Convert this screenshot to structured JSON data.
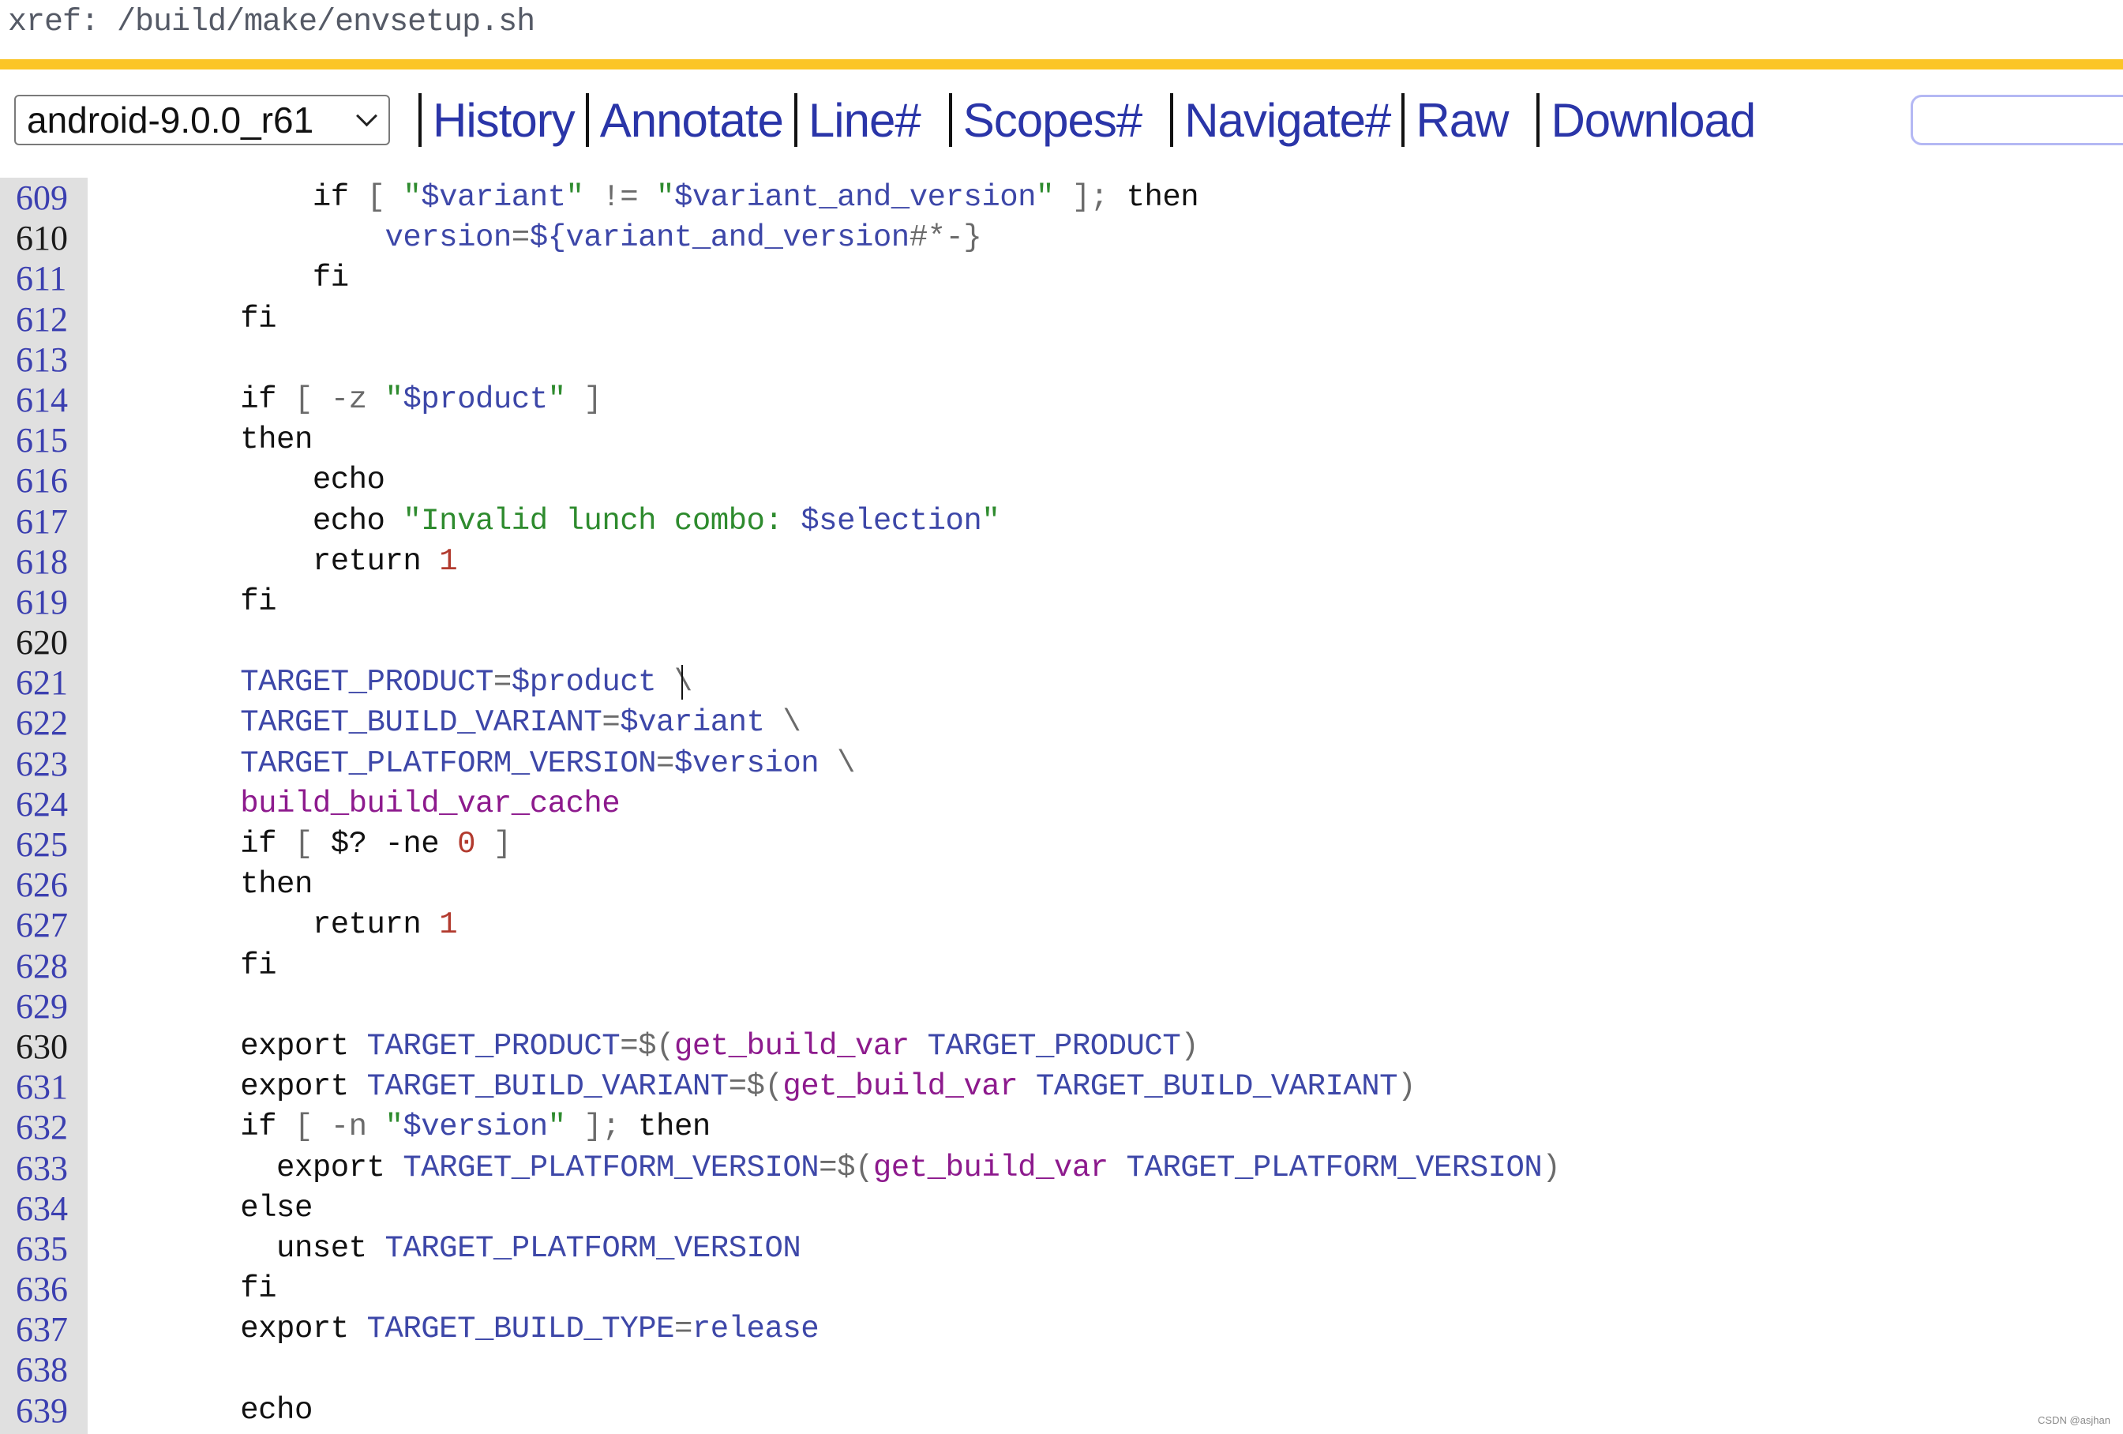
{
  "header": {
    "title": "xref: /build/make/envsetup.sh"
  },
  "toolbar": {
    "branch_select": {
      "value": "android-9.0.0_r61",
      "icon": "chevron-down-icon"
    },
    "links": [
      "History",
      "Annotate",
      "Line#",
      "Scopes#",
      "Navigate#",
      "Raw",
      "Download"
    ],
    "search": {
      "value": "",
      "placeholder": ""
    }
  },
  "colors": {
    "accent_bar": "#fbc527",
    "link": "#2a35a8",
    "line_number": "#3b3fb0",
    "gutter": "#e0e0e0",
    "string": "#2e8b2e",
    "variable": "#3d47a8",
    "number": "#b23a2e",
    "function": "#8d1a8d"
  },
  "code": {
    "lines": [
      {
        "n": "609",
        "tokens": [
          [
            "k",
            "            if "
          ],
          [
            "p",
            "[ "
          ],
          [
            "s",
            "\""
          ],
          [
            "v",
            "$variant"
          ],
          [
            "s",
            "\""
          ],
          [
            "p",
            " != "
          ],
          [
            "s",
            "\""
          ],
          [
            "v",
            "$variant_and_version"
          ],
          [
            "s",
            "\""
          ],
          [
            "p",
            " ]; "
          ],
          [
            "k",
            "then"
          ]
        ]
      },
      {
        "n": "610",
        "tokens": [
          [
            "v",
            "                version"
          ],
          [
            "p",
            "="
          ],
          [
            "v",
            "${variant_and_version"
          ],
          [
            "p",
            "#*-}"
          ]
        ]
      },
      {
        "n": "611",
        "tokens": [
          [
            "k",
            "            fi"
          ]
        ]
      },
      {
        "n": "612",
        "tokens": [
          [
            "k",
            "        fi"
          ]
        ]
      },
      {
        "n": "613",
        "tokens": []
      },
      {
        "n": "614",
        "tokens": [
          [
            "k",
            "        if "
          ],
          [
            "p",
            "[ -z "
          ],
          [
            "s",
            "\""
          ],
          [
            "v",
            "$product"
          ],
          [
            "s",
            "\""
          ],
          [
            "p",
            " ]"
          ]
        ]
      },
      {
        "n": "615",
        "tokens": [
          [
            "k",
            "        then"
          ]
        ]
      },
      {
        "n": "616",
        "tokens": [
          [
            "k",
            "            echo"
          ]
        ]
      },
      {
        "n": "617",
        "tokens": [
          [
            "k",
            "            echo "
          ],
          [
            "s",
            "\"Invalid lunch combo: "
          ],
          [
            "v",
            "$selection"
          ],
          [
            "s",
            "\""
          ]
        ]
      },
      {
        "n": "618",
        "tokens": [
          [
            "k",
            "            return "
          ],
          [
            "n",
            "1"
          ]
        ]
      },
      {
        "n": "619",
        "tokens": [
          [
            "k",
            "        fi"
          ]
        ]
      },
      {
        "n": "620",
        "tokens": []
      },
      {
        "n": "621",
        "tokens": [
          [
            "v",
            "        TARGET_PRODUCT"
          ],
          [
            "p",
            "="
          ],
          [
            "v",
            "$product"
          ],
          [
            "p",
            " \\"
          ]
        ],
        "cursor": true
      },
      {
        "n": "622",
        "tokens": [
          [
            "v",
            "        TARGET_BUILD_VARIANT"
          ],
          [
            "p",
            "="
          ],
          [
            "v",
            "$variant"
          ],
          [
            "p",
            " \\"
          ]
        ]
      },
      {
        "n": "623",
        "tokens": [
          [
            "v",
            "        TARGET_PLATFORM_VERSION"
          ],
          [
            "p",
            "="
          ],
          [
            "v",
            "$version"
          ],
          [
            "p",
            " \\"
          ]
        ]
      },
      {
        "n": "624",
        "tokens": [
          [
            "f",
            "        build_build_var_cache"
          ]
        ]
      },
      {
        "n": "625",
        "tokens": [
          [
            "k",
            "        if "
          ],
          [
            "p",
            "[ "
          ],
          [
            "k",
            "$? -ne "
          ],
          [
            "n",
            "0"
          ],
          [
            "p",
            " ]"
          ]
        ]
      },
      {
        "n": "626",
        "tokens": [
          [
            "k",
            "        then"
          ]
        ]
      },
      {
        "n": "627",
        "tokens": [
          [
            "k",
            "            return "
          ],
          [
            "n",
            "1"
          ]
        ]
      },
      {
        "n": "628",
        "tokens": [
          [
            "k",
            "        fi"
          ]
        ]
      },
      {
        "n": "629",
        "tokens": []
      },
      {
        "n": "630",
        "tokens": [
          [
            "k",
            "        export "
          ],
          [
            "v",
            "TARGET_PRODUCT"
          ],
          [
            "p",
            "=$("
          ],
          [
            "f",
            "get_build_var"
          ],
          [
            "v",
            " TARGET_PRODUCT"
          ],
          [
            "p",
            ")"
          ]
        ]
      },
      {
        "n": "631",
        "tokens": [
          [
            "k",
            "        export "
          ],
          [
            "v",
            "TARGET_BUILD_VARIANT"
          ],
          [
            "p",
            "=$("
          ],
          [
            "f",
            "get_build_var"
          ],
          [
            "v",
            " TARGET_BUILD_VARIANT"
          ],
          [
            "p",
            ")"
          ]
        ]
      },
      {
        "n": "632",
        "tokens": [
          [
            "k",
            "        if "
          ],
          [
            "p",
            "[ -n "
          ],
          [
            "s",
            "\""
          ],
          [
            "v",
            "$version"
          ],
          [
            "s",
            "\""
          ],
          [
            "p",
            " ]; "
          ],
          [
            "k",
            "then"
          ]
        ]
      },
      {
        "n": "633",
        "tokens": [
          [
            "k",
            "          export "
          ],
          [
            "v",
            "TARGET_PLATFORM_VERSION"
          ],
          [
            "p",
            "=$("
          ],
          [
            "f",
            "get_build_var"
          ],
          [
            "v",
            " TARGET_PLATFORM_VERSION"
          ],
          [
            "p",
            ")"
          ]
        ]
      },
      {
        "n": "634",
        "tokens": [
          [
            "k",
            "        else"
          ]
        ]
      },
      {
        "n": "635",
        "tokens": [
          [
            "k",
            "          unset "
          ],
          [
            "v",
            "TARGET_PLATFORM_VERSION"
          ]
        ]
      },
      {
        "n": "636",
        "tokens": [
          [
            "k",
            "        fi"
          ]
        ]
      },
      {
        "n": "637",
        "tokens": [
          [
            "k",
            "        export "
          ],
          [
            "v",
            "TARGET_BUILD_TYPE"
          ],
          [
            "p",
            "="
          ],
          [
            "v",
            "release"
          ]
        ]
      },
      {
        "n": "638",
        "tokens": []
      },
      {
        "n": "639",
        "tokens": [
          [
            "k",
            "        echo"
          ]
        ]
      }
    ]
  },
  "watermark": "CSDN @asjhan"
}
